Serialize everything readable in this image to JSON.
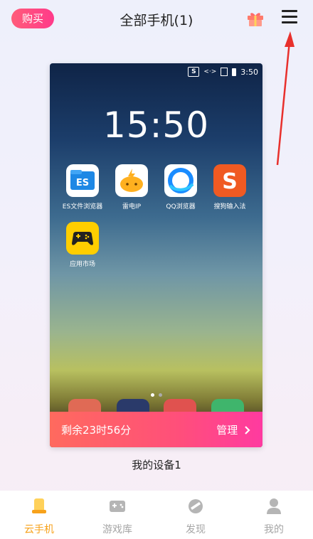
{
  "header": {
    "buy_label": "购买",
    "title": "全部手机(1)",
    "gift_icon": "gift-icon",
    "menu_icon": "menu-icon"
  },
  "phone": {
    "status": {
      "carrier_icon": "S",
      "time": "3:50"
    },
    "clock": "15:50",
    "apps": [
      {
        "label": "ES文件浏览器",
        "icon": "es-file-browser-icon"
      },
      {
        "label": "雷电IP",
        "icon": "leidian-ip-icon"
      },
      {
        "label": "QQ浏览器",
        "icon": "qq-browser-icon"
      },
      {
        "label": "搜狗输入法",
        "icon": "sogou-input-icon"
      },
      {
        "label": "应用市场",
        "icon": "app-market-icon"
      }
    ],
    "remaining": "剩余23时56分",
    "manage_label": "管理",
    "manage_icon": "chevron-right-icon"
  },
  "device_name": "我的设备1",
  "bottom_nav": [
    {
      "label": "云手机",
      "icon": "cloud-phone-icon",
      "active": true
    },
    {
      "label": "游戏库",
      "icon": "gamepad-icon",
      "active": false
    },
    {
      "label": "发现",
      "icon": "discover-icon",
      "active": false
    },
    {
      "label": "我的",
      "icon": "profile-icon",
      "active": false
    }
  ],
  "colors": {
    "accent": "#f7a21b",
    "buy": "#ff4d80",
    "remain_bar": "#ff4f7a"
  }
}
